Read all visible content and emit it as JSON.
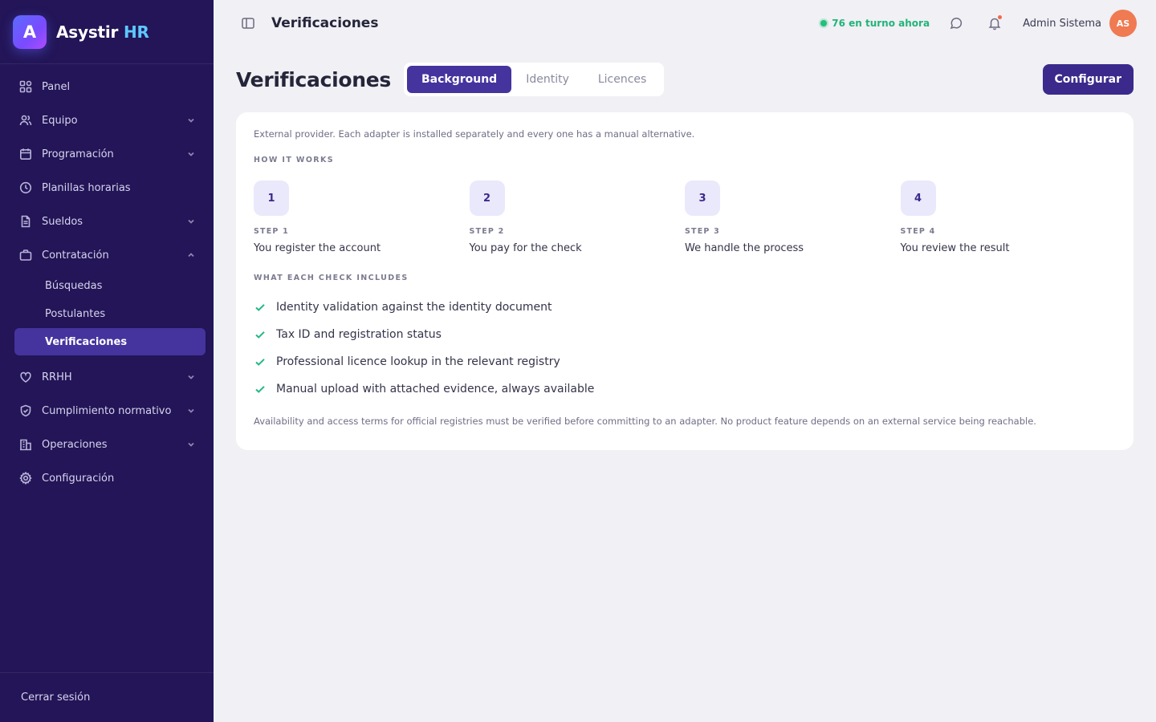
{
  "brand": {
    "logo_letter": "A",
    "name": "Asystir",
    "accent": "HR"
  },
  "sidebar": {
    "items": [
      {
        "label": "Panel",
        "icon": "grid-icon"
      },
      {
        "label": "Equipo",
        "icon": "users-icon"
      },
      {
        "label": "Programación",
        "icon": "calendar-icon"
      },
      {
        "label": "Planillas horarias",
        "icon": "clock-icon"
      },
      {
        "label": "Sueldos",
        "icon": "document-icon"
      },
      {
        "label": "Contratación",
        "icon": "briefcase-icon",
        "expanded": true,
        "children": [
          {
            "label": "Búsquedas"
          },
          {
            "label": "Postulantes"
          },
          {
            "label": "Verificaciones",
            "active": true
          }
        ]
      },
      {
        "label": "RRHH",
        "icon": "heart-icon"
      },
      {
        "label": "Cumplimiento normativo",
        "icon": "shield-icon"
      },
      {
        "label": "Operaciones",
        "icon": "building-icon"
      },
      {
        "label": "Configuración",
        "icon": "gear-icon"
      }
    ],
    "logout": "Cerrar sesión"
  },
  "topbar": {
    "title": "Verificaciones",
    "oncall": "76 en turno ahora",
    "user_name": "Admin Sistema",
    "avatar_initials": "AS"
  },
  "page": {
    "title": "Verificaciones",
    "tabs": [
      {
        "label": "Background",
        "active": true
      },
      {
        "label": "Identity"
      },
      {
        "label": "Licences"
      }
    ],
    "config_button": "Configurar"
  },
  "card": {
    "description": "External provider. Each adapter is installed separately and every one has a manual alternative.",
    "how_label": "HOW IT WORKS",
    "steps": [
      {
        "num": "1",
        "label": "STEP 1",
        "text": "You register the account"
      },
      {
        "num": "2",
        "label": "STEP 2",
        "text": "You pay for the check"
      },
      {
        "num": "3",
        "label": "STEP 3",
        "text": "We handle the process"
      },
      {
        "num": "4",
        "label": "STEP 4",
        "text": "You review the result"
      }
    ],
    "includes_label": "WHAT EACH CHECK INCLUDES",
    "checks": [
      "Identity validation against the identity document",
      "Tax ID and registration status",
      "Professional licence lookup in the relevant registry",
      "Manual upload with attached evidence, always available"
    ],
    "footnote": "Availability and access terms for official registries must be verified before committing to an adapter. No product feature depends on an external service being reachable."
  },
  "colors": {
    "sidebar_bg": "#231557",
    "primary": "#45349e",
    "button": "#3b2a8c",
    "success": "#22b478",
    "avatar": "#f07a52"
  }
}
